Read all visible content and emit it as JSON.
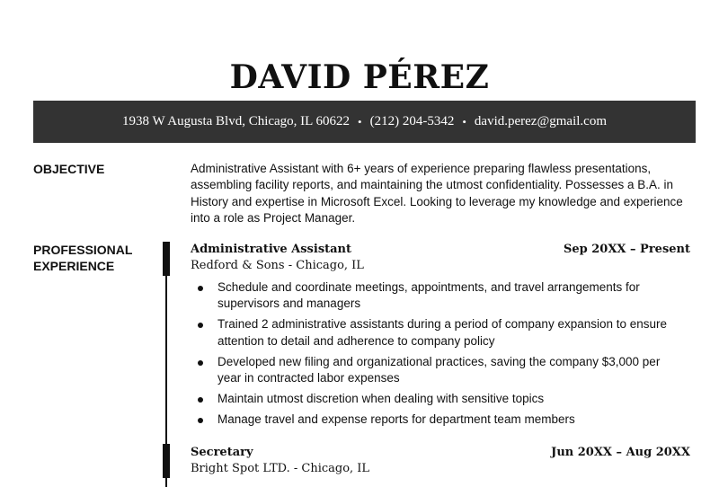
{
  "header": {
    "name": "DAVID PÉREZ",
    "address": "1938 W Augusta Blvd, Chicago, IL 60622",
    "phone": "(212) 204-5342",
    "email": "david.perez@gmail.com",
    "separator": "•"
  },
  "objective": {
    "title": "OBJECTIVE",
    "text": "Administrative Assistant with 6+ years of experience preparing flawless presentations, assembling facility reports, and maintaining the utmost confidentiality. Possesses a B.A. in History and expertise in Microsoft Excel. Looking to leverage my knowledge and experience into a role as Project Manager."
  },
  "experience": {
    "title_line1": "PROFESSIONAL",
    "title_line2": "EXPERIENCE",
    "jobs": [
      {
        "title": "Administrative Assistant",
        "dates": "Sep 20XX – Present",
        "company": "Redford & Sons - Chicago, IL",
        "bullets": [
          "Schedule and coordinate meetings, appointments, and travel arrangements for supervisors and managers",
          "Trained 2 administrative assistants during a period of company expansion to ensure attention to detail and adherence to company policy",
          "Developed new filing and organizational practices, saving the company $3,000 per year in contracted labor expenses",
          "Maintain utmost discretion when dealing with sensitive topics",
          "Manage travel and expense reports for department team members"
        ]
      },
      {
        "title": "Secretary",
        "dates": "Jun 20XX – Aug 20XX",
        "company": "Bright Spot LTD. - Chicago, IL"
      }
    ]
  }
}
